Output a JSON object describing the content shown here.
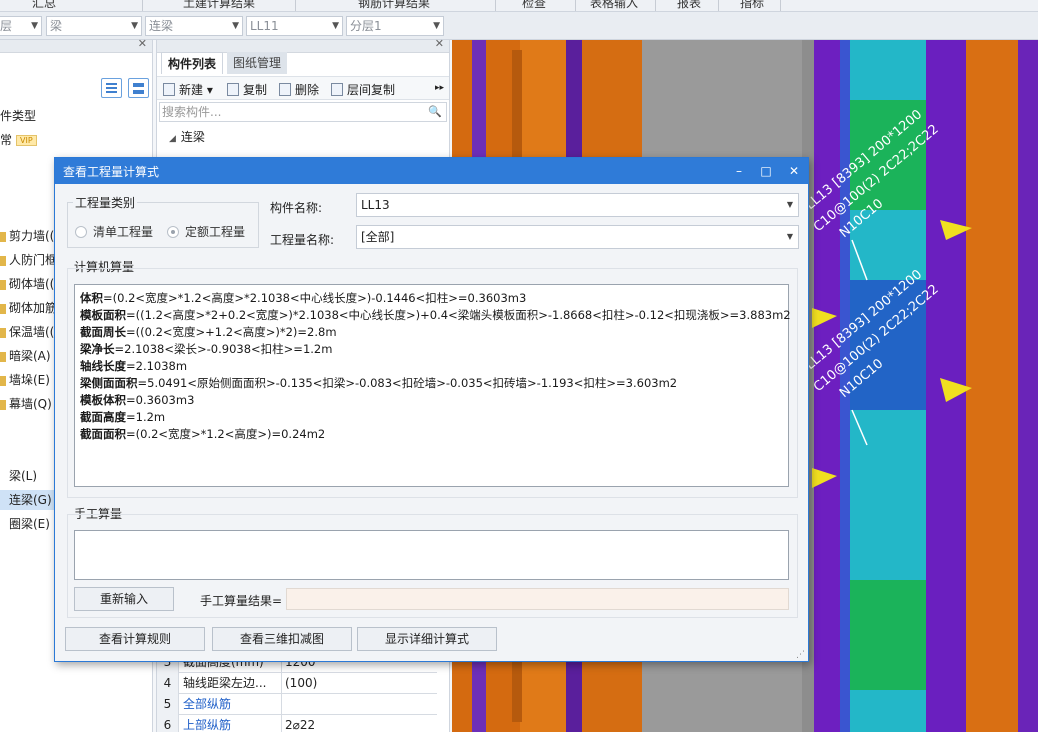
{
  "top_menu": {
    "items": [
      "汇总",
      "土建计算结果",
      "钢筋计算结果",
      "检查",
      "表格输入",
      "报表",
      "指标"
    ]
  },
  "toolbar": {
    "floor": "层",
    "category": "梁",
    "type": "连梁",
    "component": "LL11",
    "layer": "分层1"
  },
  "left_panel": {
    "items": [
      {
        "label": "件类型"
      },
      {
        "label": "",
        "badge": "VIP"
      },
      {
        "label": "剪力墙(("
      },
      {
        "label": "人防门框"
      },
      {
        "label": "砌体墙(("
      },
      {
        "label": "砌体加筋"
      },
      {
        "label": "保温墙(("
      },
      {
        "label": "暗梁(A)"
      },
      {
        "label": "墙垛(E)"
      },
      {
        "label": "幕墙(Q)"
      },
      {
        "label": "梁(L)"
      },
      {
        "label": "连梁(G)"
      },
      {
        "label": "圈梁(E)"
      }
    ]
  },
  "mid_panel": {
    "tabs": [
      "构件列表",
      "图纸管理"
    ],
    "tools": {
      "new": "新建",
      "copy": "复制",
      "delete": "删除",
      "floor_copy": "层间复制"
    },
    "search_placeholder": "搜索构件...",
    "tree_root": "连梁",
    "props": [
      {
        "num": "3",
        "name": "截面高度(mm)",
        "value": "1200",
        "blue": false
      },
      {
        "num": "4",
        "name": "轴线距梁左边...",
        "value": "(100)",
        "blue": false
      },
      {
        "num": "5",
        "name": "全部纵筋",
        "value": "",
        "blue": true
      },
      {
        "num": "6",
        "name": "上部纵筋",
        "value": "2⌀22",
        "blue": true
      }
    ]
  },
  "viewport": {
    "labels": [
      "LL13 [8393] 200*1200",
      "C10@100(2) 2C22;2C22",
      "N10C10",
      "LL13 [8393] 200*1200",
      "C10@100(2) 2C22;2C22",
      "N10C10"
    ]
  },
  "dialog": {
    "title": "查看工程量计算式",
    "window_buttons": {
      "minimize": "–",
      "maximize": "□",
      "close": "✕"
    },
    "qty_type_label": "工程量类别",
    "radio_list": "清单工程量",
    "radio_quota": "定额工程量",
    "component_name_label": "构件名称:",
    "component_name_value": "LL13",
    "qty_name_label": "工程量名称:",
    "qty_name_value": "[全部]",
    "computer_calc_label": "计算机算量",
    "calc_lines": [
      {
        "key": "体积",
        "expr": "=(0.2<宽度>*1.2<高度>*2.1038<中心线长度>)-0.1446<扣柱>=0.3603m3"
      },
      {
        "key": "模板面积",
        "expr": "=((1.2<高度>*2+0.2<宽度>)*2.1038<中心线长度>)+0.4<梁端头模板面积>-1.8668<扣柱>-0.12<扣现浇板>=3.883m2"
      },
      {
        "key": "截面周长",
        "expr": "=((0.2<宽度>+1.2<高度>)*2)=2.8m"
      },
      {
        "key": "梁净长",
        "expr": "=2.1038<梁长>-0.9038<扣柱>=1.2m"
      },
      {
        "key": "轴线长度",
        "expr": "=2.1038m"
      },
      {
        "key": "梁侧面面积",
        "expr": "=5.0491<原始侧面面积>-0.135<扣梁>-0.083<扣砼墙>-0.035<扣砖墙>-1.193<扣柱>=3.603m2"
      },
      {
        "key": "模板体积",
        "expr": "=0.3603m3"
      },
      {
        "key": "截面高度",
        "expr": "=1.2m"
      },
      {
        "key": "截面面积",
        "expr": "=(0.2<宽度>*1.2<高度>)=0.24m2"
      }
    ],
    "manual_calc_label": "手工算量",
    "reinput_button": "重新输入",
    "manual_result_label": "手工算量结果=",
    "view_rules_button": "查看计算规则",
    "view_3d_button": "查看三维扣减图",
    "show_detail_button": "显示详细计算式"
  }
}
